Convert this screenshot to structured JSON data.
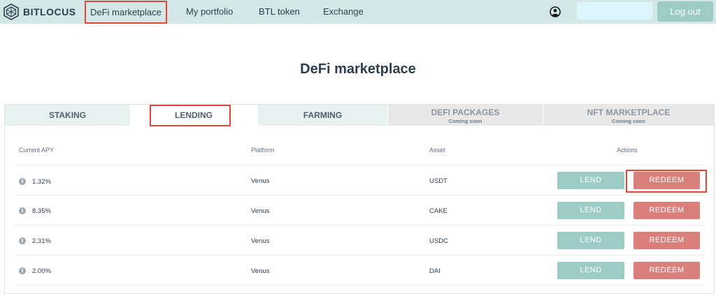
{
  "header": {
    "logo_text": "BITLOCUS",
    "logo_icon": "bitlocus-hexagon-logo",
    "nav": [
      {
        "label": "DeFi marketplace"
      },
      {
        "label": "My portfolio"
      },
      {
        "label": "BTL token"
      },
      {
        "label": "Exchange"
      }
    ],
    "user_icon": "user-circle-icon",
    "logout_label": "Log out"
  },
  "page_title": "DeFi marketplace",
  "tabs": [
    {
      "label": "STAKING",
      "sub": ""
    },
    {
      "label": "LENDING",
      "sub": ""
    },
    {
      "label": "FARMING",
      "sub": ""
    },
    {
      "label": "DEFI PACKAGES",
      "sub": "Coming soon"
    },
    {
      "label": "NFT MARKETPLACE",
      "sub": "Coming soon"
    }
  ],
  "table": {
    "headers": [
      "Current APY",
      "Platform",
      "Asset",
      "Actions"
    ],
    "rows": [
      {
        "apy": "1.32%",
        "platform": "Venus",
        "asset": "USDT",
        "lend": "LEND",
        "redeem": "REDEEM"
      },
      {
        "apy": "8.35%",
        "platform": "Venus",
        "asset": "CAKE",
        "lend": "LEND",
        "redeem": "REDEEM"
      },
      {
        "apy": "2.31%",
        "platform": "Venus",
        "asset": "USDC",
        "lend": "LEND",
        "redeem": "REDEEM"
      },
      {
        "apy": "2.00%",
        "platform": "Venus",
        "asset": "DAI",
        "lend": "LEND",
        "redeem": "REDEEM"
      }
    ],
    "info_icon_glyph": "i"
  },
  "colors": {
    "topbar": "#d3e8e6",
    "accent": "#9dcbc5",
    "redeem": "#d9807d",
    "highlight": "#e0473a"
  }
}
